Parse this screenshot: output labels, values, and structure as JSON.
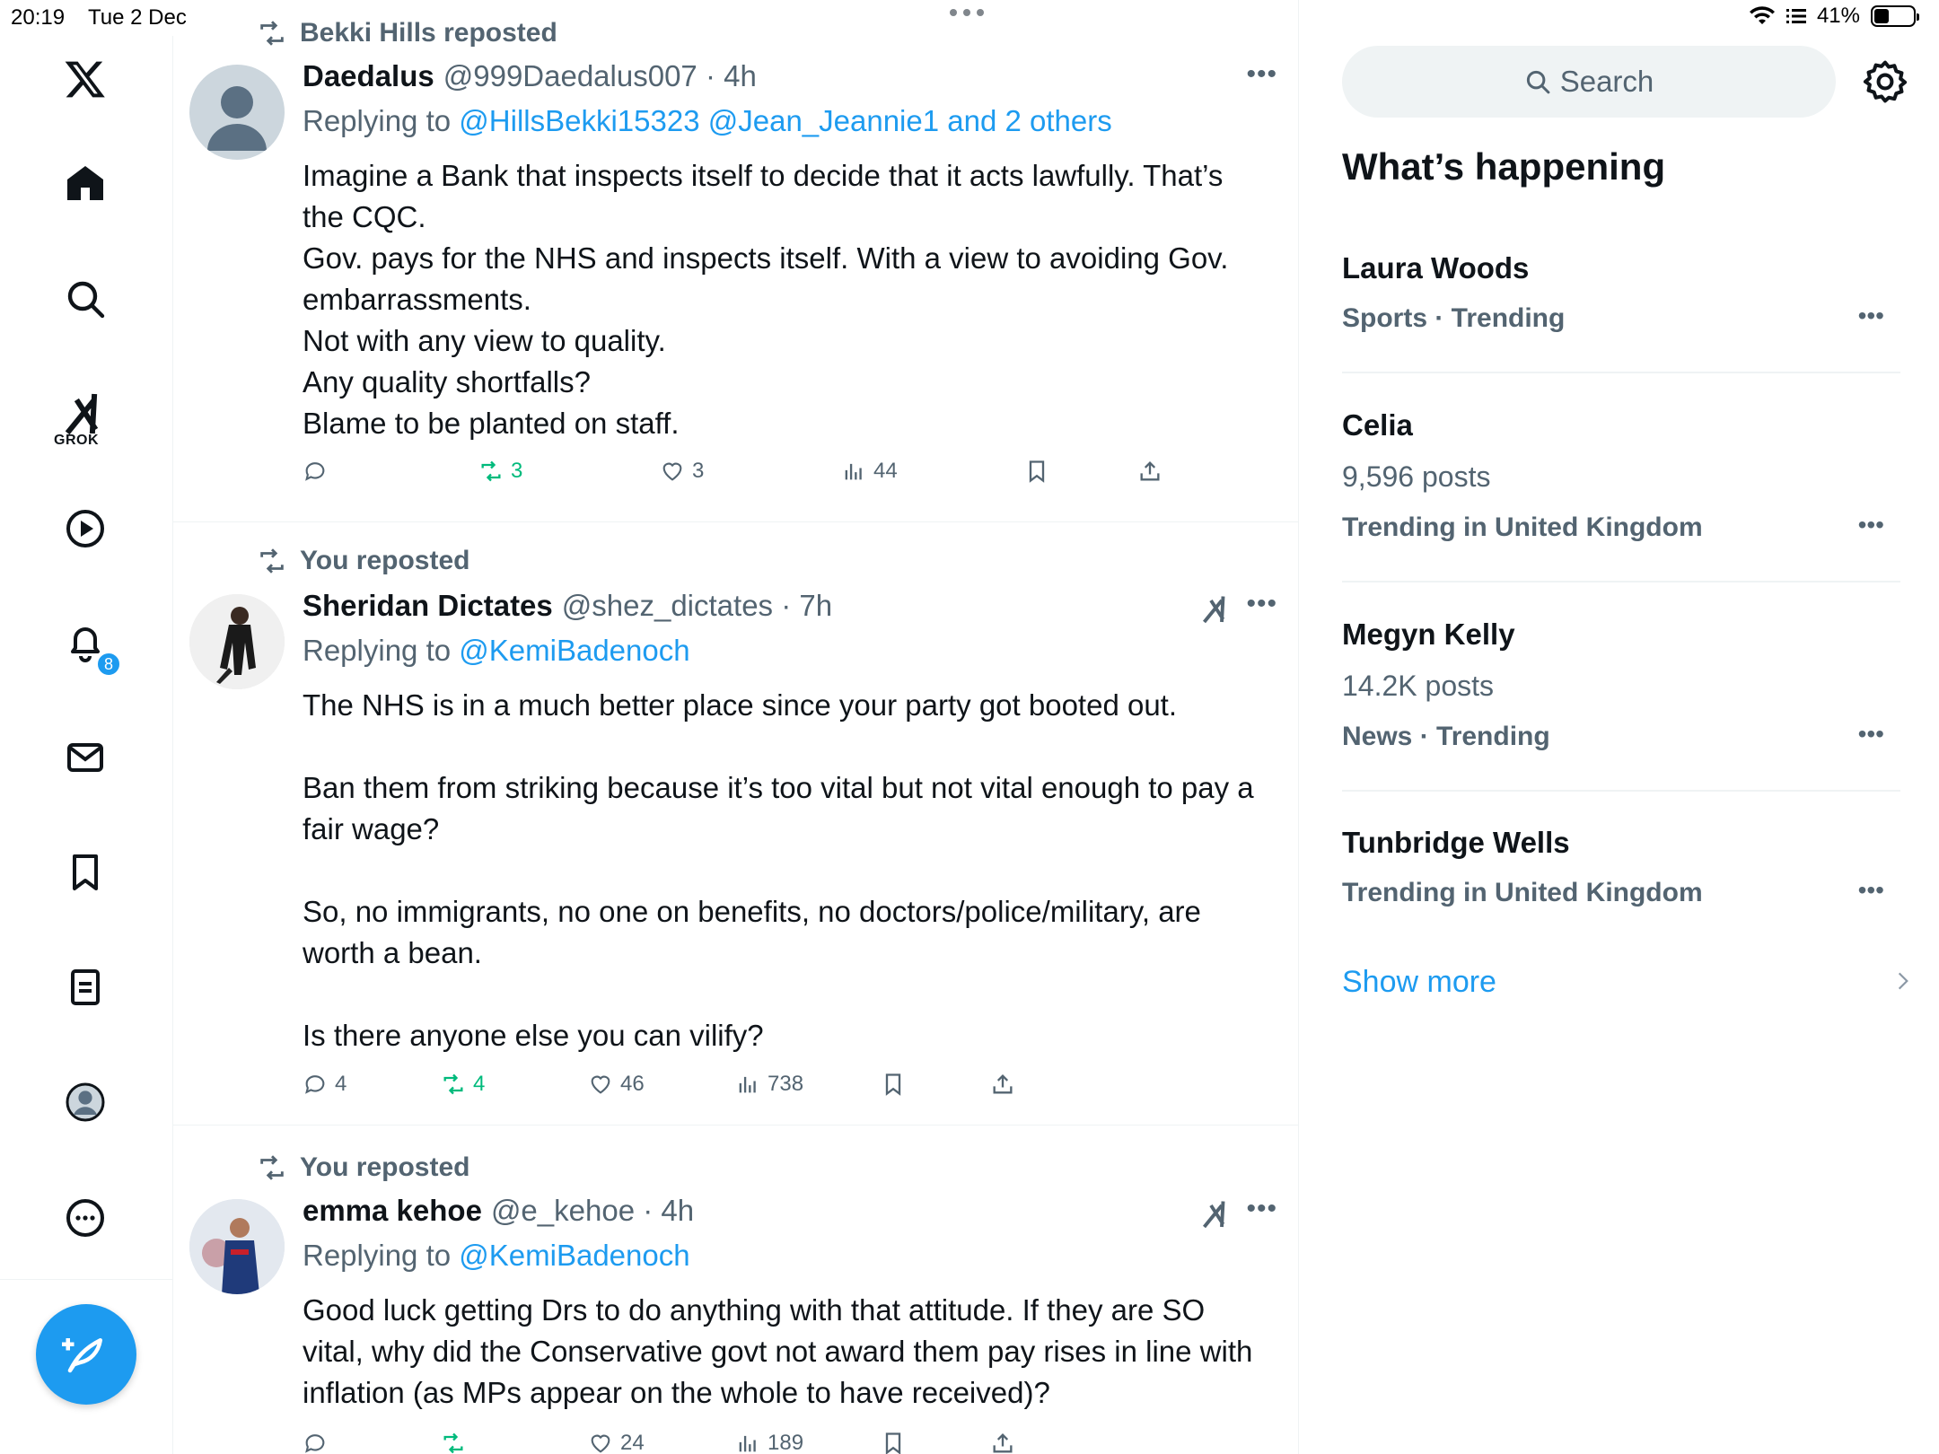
{
  "status_bar": {
    "time": "20:19",
    "date": "Tue 2 Dec",
    "battery": "41%",
    "battery_level": 0.41
  },
  "nav": {
    "grok_label": "GROK",
    "notifications_count": "8"
  },
  "search": {
    "placeholder": "Search"
  },
  "posts": [
    {
      "repost_label": "Bekki Hills reposted",
      "author": "Daedalus",
      "handle_time": "@999Daedalus007 · 4h",
      "replying_prefix": "Replying to",
      "replying_to": "@HillsBekki15323 @Jean_Jeannie1 and 2 others",
      "lines": [
        "Imagine a Bank that inspects itself to decide that it acts lawfully. That’s the CQC.",
        "Gov. pays for the NHS and inspects itself. With a view to avoiding Gov. embarrassments.",
        "Not with any view to quality.",
        "Any quality shortfalls?",
        "Blame to be planted on staff."
      ],
      "replies": "",
      "reposts": "3",
      "likes": "3",
      "views": "44"
    },
    {
      "repost_label": "You reposted",
      "author": "Sheridan Dictates",
      "handle_time": "@shez_dictates · 7h",
      "replying_prefix": "Replying to",
      "replying_to": "@KemiBadenoch",
      "lines": [
        "The NHS is in a much better place since your party got booted out.",
        "",
        "Ban them from striking because it’s too vital but not vital enough to pay a fair wage?",
        "",
        "So, no immigrants, no one on benefits, no doctors/police/military, are worth a bean.",
        "",
        "Is there anyone else you can vilify?"
      ],
      "replies": "4",
      "reposts": "4",
      "likes": "46",
      "views": "738"
    },
    {
      "repost_label": "You reposted",
      "author": "emma kehoe",
      "handle_time": "@e_kehoe · 4h",
      "replying_prefix": "Replying to",
      "replying_to": "@KemiBadenoch",
      "lines": [
        "Good luck getting Drs to do anything with that attitude. If they are SO vital, why did the Conservative govt not award them pay rises in line with inflation (as MPs appear on the whole to have received)?"
      ],
      "replies": "",
      "reposts": "",
      "likes": "24",
      "views": "189"
    }
  ],
  "sidebar": {
    "title": "What’s happening",
    "trends": [
      {
        "name": "Laura Woods",
        "posts": "",
        "category": "Sports · Trending"
      },
      {
        "name": "Celia",
        "posts": "9,596 posts",
        "category": "Trending in United Kingdom"
      },
      {
        "name": "Megyn Kelly",
        "posts": "14.2K posts",
        "category": "News · Trending"
      },
      {
        "name": "Tunbridge Wells",
        "posts": "",
        "category": "Trending in United Kingdom"
      }
    ],
    "show_more": "Show more"
  }
}
